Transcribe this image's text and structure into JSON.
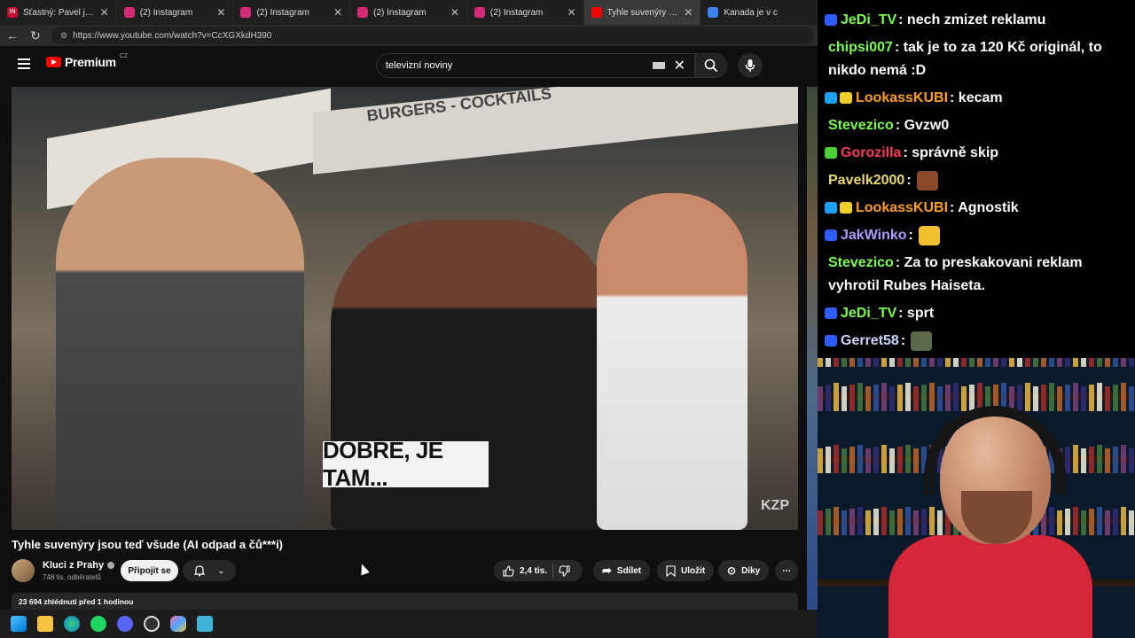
{
  "browser": {
    "tabs": [
      {
        "title": "Šťastný: Pavel je lídr opozice",
        "fav_color": "#c8102e",
        "fav_text": "IN",
        "active": false
      },
      {
        "title": "(2) Instagram",
        "fav_color": "#d62976",
        "active": false
      },
      {
        "title": "(2) Instagram",
        "fav_color": "#d62976",
        "active": false
      },
      {
        "title": "(2) Instagram",
        "fav_color": "#d62976",
        "active": false
      },
      {
        "title": "(2) Instagram",
        "fav_color": "#d62976",
        "active": false
      },
      {
        "title": "Tyhle suvenýry jsou teď",
        "fav_color": "#ff0000",
        "active": true
      },
      {
        "title": "Kanada je v c",
        "fav_color": "#3b82f6",
        "active": false
      }
    ],
    "url": "https://www.youtube.com/watch?v=CcXGXkdH390"
  },
  "youtube": {
    "logo_text": "Premium",
    "logo_region": "CZ",
    "search_value": "televizní noviny",
    "video": {
      "caption": "DOBŘE, JE TAM...",
      "watermark": "KZP"
    },
    "title": "Tyhle suvenýry jsou teď všude (AI odpad a čů***i)",
    "channel": {
      "name": "Kluci z Prahy",
      "subscribers": "748 tis. odběratelů",
      "join_label": "Připojit se"
    },
    "actions": {
      "likes": "2,4 tis.",
      "share": "Sdílet",
      "save": "Uložit",
      "thanks": "Díky",
      "more": "⋯"
    },
    "info": "23 694 zhlédnutí  před 1 hodinou"
  },
  "chat": {
    "messages": [
      {
        "nick": "JeDi_TV",
        "color": "#7cff4a",
        "text": ": nech zmizet reklamu",
        "badges": [
          "#2f5cff"
        ]
      },
      {
        "nick": "chipsi007",
        "color": "#7cff4a",
        "text": ": tak je to za 120 Kč originál, to nikdo nemá :D",
        "badges": []
      },
      {
        "nick": "LookassKUBI",
        "color": "#ff9f1a",
        "text": ": kecam",
        "badges": [
          "#1da1f2",
          "#f0d028"
        ]
      },
      {
        "nick": "Stevezico",
        "color": "#7cff4a",
        "text": ": Gvzw0",
        "badges": []
      },
      {
        "nick": "Gorozilla",
        "color": "#ff3b5c",
        "text": ": správně skip",
        "badges": [
          "#4cd137"
        ]
      },
      {
        "nick": "Pavelk2000",
        "color": "#e8d96a",
        "text": ":",
        "badges": [],
        "emote": "#8a4a2a"
      },
      {
        "nick": "LookassKUBI",
        "color": "#ff9f1a",
        "text": ": Agnostik",
        "badges": [
          "#1da1f2",
          "#f0d028"
        ]
      },
      {
        "nick": "JakWinko",
        "color": "#b09cff",
        "text": ":",
        "badges": [
          "#2f5cff"
        ],
        "emote": "#f0c030"
      },
      {
        "nick": "Stevezico",
        "color": "#7cff4a",
        "text": ": Za to preskakovani reklam vyhrotil Rubes Haiseta.",
        "badges": []
      },
      {
        "nick": "JeDi_TV",
        "color": "#7cff4a",
        "text": ": sprt",
        "badges": [
          "#2f5cff"
        ]
      },
      {
        "nick": "Gerret58",
        "color": "#c9d6ff",
        "text": ":",
        "badges": [
          "#2f5cff"
        ],
        "emote": "#5a6a4a"
      }
    ]
  },
  "taskbar": {
    "icons": [
      "windows-start-icon",
      "file-explorer-icon",
      "edge-icon",
      "spotify-icon",
      "discord-icon",
      "obs-icon",
      "copilot-icon",
      "notepad-icon"
    ]
  }
}
